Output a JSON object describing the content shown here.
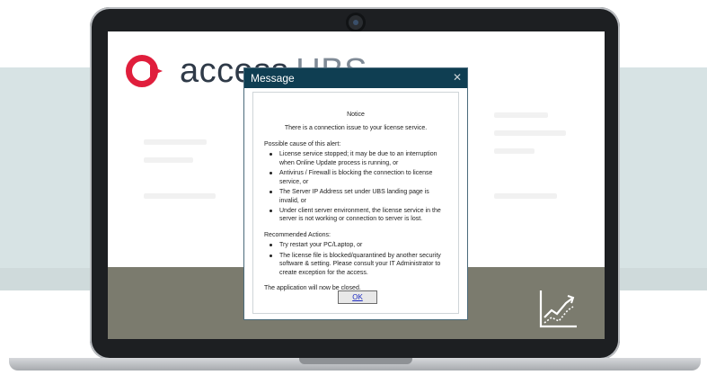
{
  "logo": {
    "brand": "access",
    "product": "UBS"
  },
  "dialog": {
    "title": "Message",
    "close_glyph": "✕",
    "notice": "Notice",
    "issue": "There is a connection issue to your license service.",
    "causes_heading": "Possible cause of this alert:",
    "causes": [
      "License service stopped; it may be due to an interruption when Online Update process is running, or",
      "Antivirus / Firewall is blocking the connection to license service, or",
      "The Server IP Address set under UBS landing page is invalid, or",
      "Under client server environment, the license service in the server is not working or connection to server is lost."
    ],
    "actions_heading": "Recommended Actions:",
    "actions": [
      "Try restart your PC/Laptop, or",
      "The license file is blocked/quarantined by another security software & setting. Please consult your IT Administrator to create exception for the access."
    ],
    "close_message": "The application will now be closed.",
    "ok_label": "OK"
  },
  "icons": {
    "chart": "trend-chart-icon",
    "close": "close-icon"
  },
  "colors": {
    "title_bar": "#0f3e52",
    "logo_red": "#e01e3c",
    "band": "#d7e3e4",
    "screen_footer": "#7b7b6e",
    "laptop_frame": "#1d1f22"
  }
}
